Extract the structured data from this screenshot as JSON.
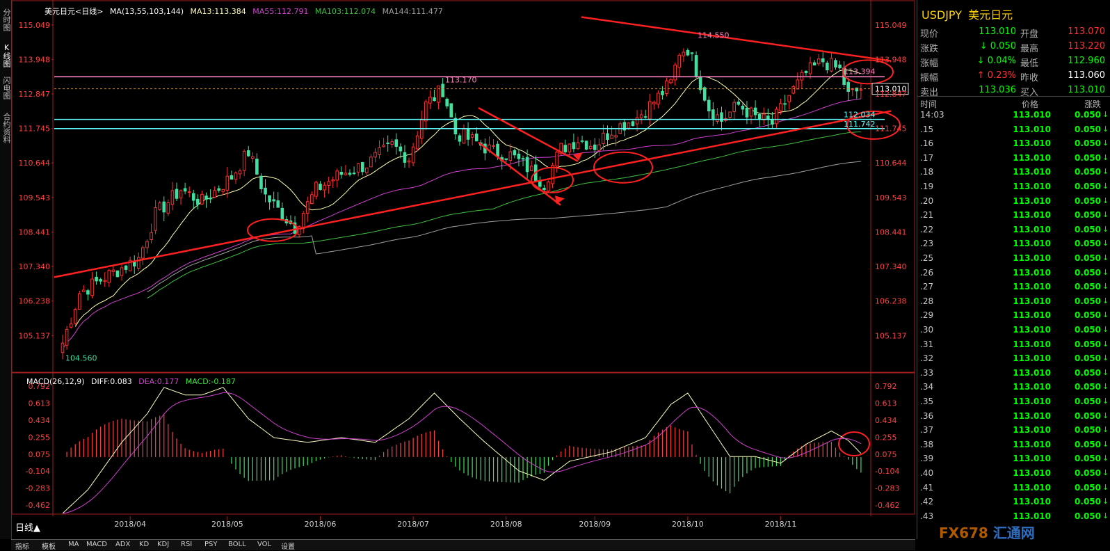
{
  "left_tabs": [
    "分时图",
    "K线图",
    "闪电图",
    "合约资料"
  ],
  "main": {
    "title": "美元日元<日线>",
    "ma_header": "MA(13,55,103,144)",
    "ma_values": [
      {
        "label": "MA13:113.384",
        "color": "#ffffb0"
      },
      {
        "label": "MA55:112.791",
        "color": "#d040d0"
      },
      {
        "label": "MA103:112.074",
        "color": "#40c040"
      },
      {
        "label": "MA144:111.477",
        "color": "#a0a0a0"
      }
    ],
    "price_ticks": [
      "115.049",
      "113.948",
      "112.847",
      "111.745",
      "110.644",
      "109.543",
      "108.441",
      "107.340",
      "106.238",
      "105.137"
    ],
    "price_range": [
      104.3,
      115.4
    ],
    "date_labels": [
      "2018/04",
      "2018/05",
      "2018/06",
      "2018/07",
      "2018/08",
      "2018/09",
      "2018/10",
      "2018/11"
    ],
    "annotations": {
      "high": "114.550",
      "mid_high": "113.170",
      "low": "104.560",
      "level_pink": "113.394",
      "level_cyan1": "112.034",
      "level_cyan2": "111.742",
      "last_price": "113.010"
    },
    "levels": {
      "pink": 113.394,
      "cyan1": 112.034,
      "cyan2": 111.742,
      "last": 113.01
    },
    "colors": {
      "up": "#ff3030",
      "down": "#40e0a0",
      "trend": "#ff2020",
      "pink": "#ff80c0",
      "cyan": "#60ffff",
      "axis_text": "#ff4040"
    }
  },
  "macd": {
    "header": "MACD(26,12,9)",
    "diff": "DIFF:0.083",
    "dea": "DEA:0.177",
    "macd": "MACD:-0.187",
    "ticks": [
      "0.792",
      "0.613",
      "0.434",
      "0.255",
      "0.075",
      "-0.104",
      "-0.283",
      "-0.462"
    ],
    "range": [
      -0.55,
      0.83
    ]
  },
  "right_panel": {
    "symbol": "USDJPY",
    "name": "美元日元",
    "rows": [
      {
        "l1": "现价",
        "v1": "113.010",
        "c1": "#00ff00",
        "l2": "开盘",
        "v2": "113.070",
        "c2": "#ff3030"
      },
      {
        "l1": "涨跌",
        "v1": "↓ 0.050",
        "c1": "#00ff00",
        "l2": "最高",
        "v2": "113.220",
        "c2": "#ff3030"
      },
      {
        "l1": "涨幅",
        "v1": "↓ 0.04%",
        "c1": "#00ff00",
        "l2": "最低",
        "v2": "112.960",
        "c2": "#00ff00"
      },
      {
        "l1": "振幅",
        "v1": "↑ 0.23%",
        "c1": "#ff3030",
        "l2": "昨收",
        "v2": "113.060",
        "c2": "#ffffff"
      },
      {
        "l1": "卖出",
        "v1": "113.036",
        "c1": "#00ff00",
        "l2": "买入",
        "v2": "113.010",
        "c2": "#00ff00"
      }
    ],
    "tick_headers": {
      "time": "时间",
      "price": "价格",
      "change": "涨跌"
    },
    "ticks": [
      {
        "t": "14:03",
        "p": "113.010",
        "c": "0.050"
      },
      {
        "t": ".15",
        "p": "113.010",
        "c": "0.050"
      },
      {
        "t": ".16",
        "p": "113.010",
        "c": "0.050"
      },
      {
        "t": ".17",
        "p": "113.010",
        "c": "0.050"
      },
      {
        "t": ".18",
        "p": "113.010",
        "c": "0.050"
      },
      {
        "t": ".19",
        "p": "113.010",
        "c": "0.050"
      },
      {
        "t": ".20",
        "p": "113.010",
        "c": "0.050"
      },
      {
        "t": ".21",
        "p": "113.010",
        "c": "0.050"
      },
      {
        "t": ".22",
        "p": "113.010",
        "c": "0.050"
      },
      {
        "t": ".23",
        "p": "113.010",
        "c": "0.050"
      },
      {
        "t": ".25",
        "p": "113.010",
        "c": "0.050"
      },
      {
        "t": ".26",
        "p": "113.010",
        "c": "0.050"
      },
      {
        "t": ".27",
        "p": "113.010",
        "c": "0.050"
      },
      {
        "t": ".28",
        "p": "113.010",
        "c": "0.050"
      },
      {
        "t": ".29",
        "p": "113.010",
        "c": "0.050"
      },
      {
        "t": ".30",
        "p": "113.010",
        "c": "0.050"
      },
      {
        "t": ".31",
        "p": "113.010",
        "c": "0.050"
      },
      {
        "t": ".32",
        "p": "113.010",
        "c": "0.050"
      },
      {
        "t": ".33",
        "p": "113.010",
        "c": "0.050"
      },
      {
        "t": ".34",
        "p": "113.010",
        "c": "0.050"
      },
      {
        "t": ".35",
        "p": "113.010",
        "c": "0.050"
      },
      {
        "t": ".36",
        "p": "113.010",
        "c": "0.050"
      },
      {
        "t": ".37",
        "p": "113.010",
        "c": "0.050"
      },
      {
        "t": ".38",
        "p": "113.010",
        "c": "0.050"
      },
      {
        "t": ".39",
        "p": "113.010",
        "c": "0.050"
      },
      {
        "t": ".40",
        "p": "113.010",
        "c": "0.050"
      },
      {
        "t": ".41",
        "p": "113.010",
        "c": "0.050"
      },
      {
        "t": ".42",
        "p": "113.010",
        "c": "0.050"
      },
      {
        "t": ".43",
        "p": "113.010",
        "c": "0.050"
      }
    ]
  },
  "bottom": {
    "period": "日线▲",
    "tabs": [
      "指标",
      "模板",
      "MA",
      "MACD",
      "ADX",
      "KD",
      "KDJ",
      "RSI",
      "PSY",
      "BOLL",
      "VOL",
      "设置"
    ]
  },
  "watermark": {
    "brand": "FX678",
    "cn": "汇通网"
  }
}
